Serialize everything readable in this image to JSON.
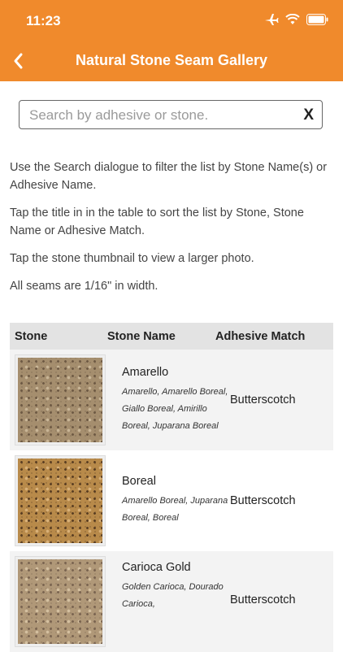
{
  "status": {
    "time": "11:23"
  },
  "header": {
    "title": "Natural Stone Seam Gallery"
  },
  "search": {
    "placeholder": "Search by adhesive or stone.",
    "clear_label": "X"
  },
  "instructions": [
    "Use the Search dialogue to filter the list by Stone Name(s) or Adhesive Name.",
    "Tap the title in in the table to sort the list by Stone, Stone Name or Adhesive Match.",
    "Tap the stone thumbnail to view a larger photo.",
    "All seams are 1/16\" in width."
  ],
  "table": {
    "headers": {
      "stone": "Stone",
      "name": "Stone Name",
      "adhesive": "Adhesive Match"
    },
    "rows": [
      {
        "name": "Amarello",
        "alt_names": "Amarello, Amarello Boreal, Giallo Boreal, Amirillo Boreal, Juparana Boreal",
        "adhesive": "Butterscotch",
        "colors": [
          "#a58e6e",
          "#6e5a44",
          "#c8b596"
        ]
      },
      {
        "name": "Boreal",
        "alt_names": "Amarello Boreal, Juparana Boreal, Boreal",
        "adhesive": "Butterscotch",
        "colors": [
          "#b88a4a",
          "#5a3e22",
          "#d8b078"
        ]
      },
      {
        "name": "Carioca Gold",
        "alt_names": "Golden Carioca, Dourado Carioca,",
        "adhesive": "Butterscotch",
        "colors": [
          "#b09878",
          "#7a6450",
          "#d4c0a0"
        ]
      }
    ]
  },
  "colors": {
    "header_bg": "#f08a2c",
    "table_header_bg": "#e3e3e3"
  }
}
